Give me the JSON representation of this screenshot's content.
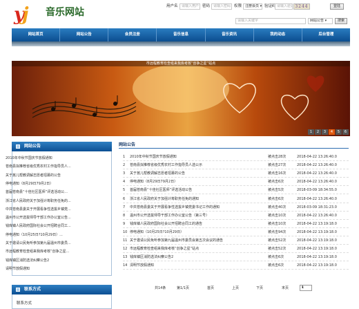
{
  "header": {
    "logo_y": "y",
    "logo_j": "j",
    "site_title": "音乐网站",
    "login": {
      "user_label": "用户名",
      "user_placeholder": "请输入用户",
      "pwd_label": "密码",
      "pwd_placeholder": "请输入密码",
      "perm_label": "权限",
      "role_select": "注册会员",
      "captcha_label": "验证码",
      "captcha_placeholder": "请输入验证",
      "captcha_code": "3244",
      "login_button": "登陆"
    },
    "search": {
      "placeholder": "请输入关键字",
      "category": "网站公告",
      "button": "搜索"
    }
  },
  "nav": [
    "网站首页",
    "网站公告",
    "会员注册",
    "音乐信息",
    "音乐资讯",
    "我的动态",
    "后台管理"
  ],
  "banner": {
    "caption": "市远程教育检查组来我库考核“创争之星”站点",
    "pages": [
      "1",
      "2",
      "3",
      "4",
      "5",
      "6"
    ],
    "active_page": "4"
  },
  "sidebar": {
    "news_title": "网站公告",
    "news": [
      "2010年中秋节国庆节放假通知",
      "苍南县拟推荐省级优秀农村工作指导员人...",
      "关于莒儿帮教调解志愿者招募的公告",
      "停电通知（8月29日79月2日）",
      "首届苍南县“十佳社区医师”评选活动公...",
      "浙江省人民政府关于加强计筹职务任免的...",
      "中共苍南县委关于开展看争性选拔乡镇党...",
      "温州市公开选拔师导干部工作办公室公告...",
      "钱库镇人民政府国际社会公开招聘合同工...",
      "停电通知（10月25日?10月29日）...",
      "关于邀请公民免听参加第九届温州市委员...",
      "市远程教育检查组来我库考核“创争之星...",
      "钱库镇区消防选法纠察公告2",
      "请明节放假通知"
    ],
    "contact_title": "联系方式",
    "contact_text": "联系方式"
  },
  "main": {
    "title": "网站公告",
    "rows": [
      {
        "n": "1",
        "title": "2010年中秋节国庆节放假通知",
        "count": "被点击28次",
        "date": "2018-04-22 13:26:40.0"
      },
      {
        "n": "2",
        "title": "苍南县拟推荐省级优秀农村工作指导员人选公示",
        "count": "被点击27次",
        "date": "2018-04-22 13:26:40.0"
      },
      {
        "n": "3",
        "title": "关于莒儿帮教调解志愿者招募的公告",
        "count": "被点击16次",
        "date": "2018-04-22 13:26:40.0"
      },
      {
        "n": "4",
        "title": "停电通知（8月29日79月2日）",
        "count": "被点击6次",
        "date": "2018-04-22 13:26:40.0"
      },
      {
        "n": "5",
        "title": "首届苍南县“十佳社区医师”评选活动公告",
        "count": "被点击5次",
        "date": "2018-03-09 18:34:55.0"
      },
      {
        "n": "6",
        "title": "浙江省人民政府关于加强计筹职务任免的通知",
        "count": "被点击6次",
        "date": "2018-04-22 13:26:40.0"
      },
      {
        "n": "7",
        "title": "中共苍南县委关于开展看争性选拔乡镇党委书记工作的通知",
        "count": "被点击40次",
        "date": "2018-03-09 18:31:23.0"
      },
      {
        "n": "8",
        "title": "温州市公开选拔师导干部工作办公室公告（第三号）",
        "count": "被点击10次",
        "date": "2018-04-22 13:26:40.0"
      },
      {
        "n": "9",
        "title": "钱库镇人民政府国际社会公开招聘合同工的通告",
        "count": "被点击10次",
        "date": "2018-04-22 13:19:18.0"
      },
      {
        "n": "10",
        "title": "停电通知（10月25日?10月29日）",
        "count": "被点击94次",
        "date": "2018-04-22 13:19:18.0"
      },
      {
        "n": "11",
        "title": "关于邀请公民免听参加第九届温州市委员会第五次会议的通告",
        "count": "被点击52次",
        "date": "2018-04-22 13:19:18.0"
      },
      {
        "n": "12",
        "title": "市远程教育检查组来我库考核“创争之星”站点",
        "count": "被点击52次",
        "date": "2018-04-22 13:19:18.0"
      },
      {
        "n": "13",
        "title": "钱库镇区消防选法纠察公告2",
        "count": "被点击6次",
        "date": "2018-04-22 13:19:18.0"
      },
      {
        "n": "14",
        "title": "清明节放假通知",
        "count": "被点击6次",
        "date": "2018-04-22 13:19:18.0"
      }
    ],
    "pager": {
      "total": "共14条",
      "page": "第1/1页",
      "first": "首页",
      "prev": "上页",
      "next": "下页",
      "last": "末页",
      "select": "1"
    }
  },
  "colors": {
    "nav": "#1260a8",
    "banner_accent": "#c85a12",
    "title_green": "#2b6a2b"
  }
}
